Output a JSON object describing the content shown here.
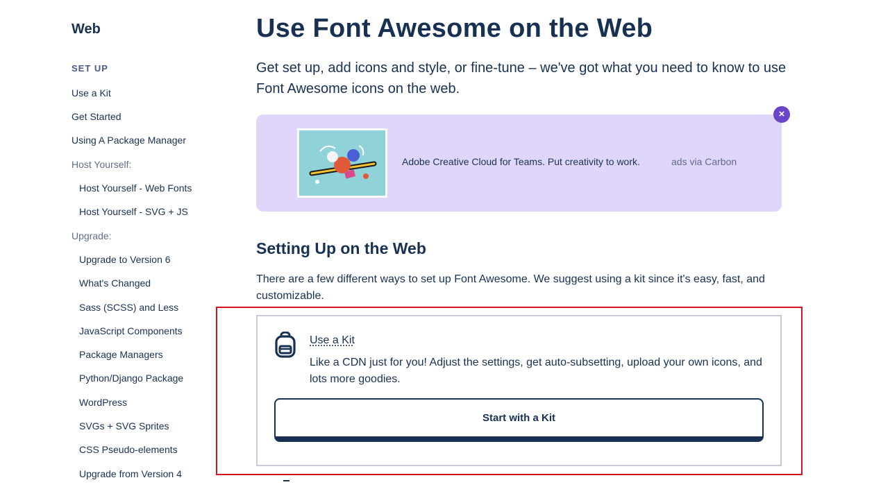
{
  "sidebar": {
    "title": "Web",
    "section": "SET UP",
    "items": [
      {
        "label": "Use a Kit",
        "level": 1
      },
      {
        "label": "Get Started",
        "level": 1
      },
      {
        "label": "Using A Package Manager",
        "level": 1
      },
      {
        "label": "Host Yourself:",
        "level": 0
      },
      {
        "label": "Host Yourself - Web Fonts",
        "level": 2
      },
      {
        "label": "Host Yourself - SVG + JS",
        "level": 2
      },
      {
        "label": "Upgrade:",
        "level": 0
      },
      {
        "label": "Upgrade to Version 6",
        "level": 2
      },
      {
        "label": "What's Changed",
        "level": 2
      },
      {
        "label": "Sass (SCSS) and Less",
        "level": 2
      },
      {
        "label": "JavaScript Components",
        "level": 2
      },
      {
        "label": "Package Managers",
        "level": 2
      },
      {
        "label": "Python/Django Package",
        "level": 2
      },
      {
        "label": "WordPress",
        "level": 2
      },
      {
        "label": "SVGs + SVG Sprites",
        "level": 2
      },
      {
        "label": "CSS Pseudo-elements",
        "level": 2
      },
      {
        "label": "Upgrade from Version 4",
        "level": 2
      }
    ]
  },
  "main": {
    "title": "Use Font Awesome on the Web",
    "lead": "Get set up, add icons and style, or fine-tune – we've got what you need to know to use Font Awesome icons on the web.",
    "ad": {
      "text": "Adobe Creative Cloud for Teams. Put creativity to work.",
      "via": "ads via Carbon",
      "close_icon": "close-icon",
      "bg_color": "#e0d6fb"
    },
    "section_title": "Setting Up on the Web",
    "section_text": "There are a few different ways to set up Font Awesome. We suggest using a kit since it's easy, fast, and customizable.",
    "card": {
      "icon": "backpack-icon",
      "link": "Use a Kit",
      "description": "Like a CDN just for you! Adjust the settings, get auto-subsetting, upload your own icons, and lots more goodies.",
      "button": "Start with a Kit"
    }
  },
  "colors": {
    "text": "#183153",
    "highlight": "#d9131d",
    "close_badge": "#6b45c9"
  }
}
